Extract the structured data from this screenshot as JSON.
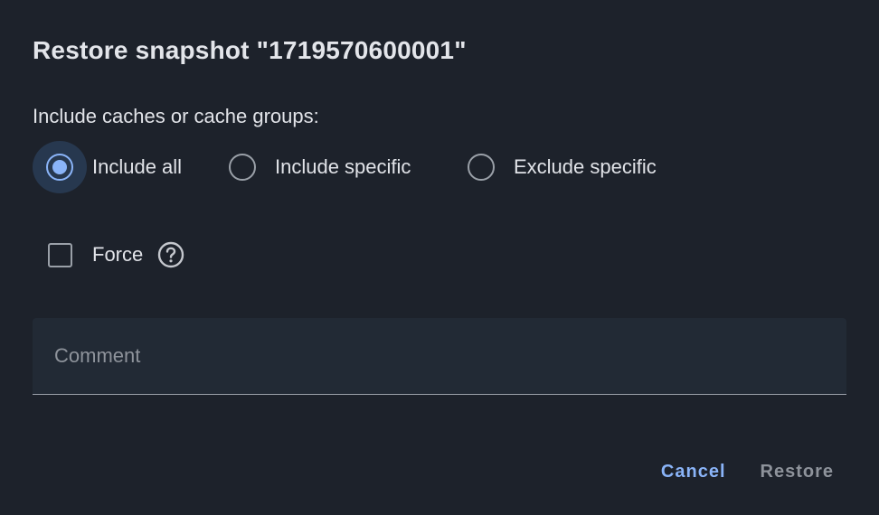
{
  "dialog": {
    "title": "Restore snapshot \"1719570600001\"",
    "include_label": "Include caches or cache groups:",
    "radio_options": [
      {
        "label": "Include all",
        "selected": true
      },
      {
        "label": "Include specific",
        "selected": false
      },
      {
        "label": "Exclude specific",
        "selected": false
      }
    ],
    "force": {
      "label": "Force",
      "checked": false,
      "help_icon": "help-circle-icon"
    },
    "comment": {
      "placeholder": "Comment",
      "value": ""
    },
    "actions": {
      "cancel_label": "Cancel",
      "restore_label": "Restore"
    }
  },
  "colors": {
    "background": "#1d222b",
    "accent": "#8ab4f8",
    "text": "#e1e3e8",
    "muted": "#8e939b",
    "field_bg": "#222a35"
  }
}
